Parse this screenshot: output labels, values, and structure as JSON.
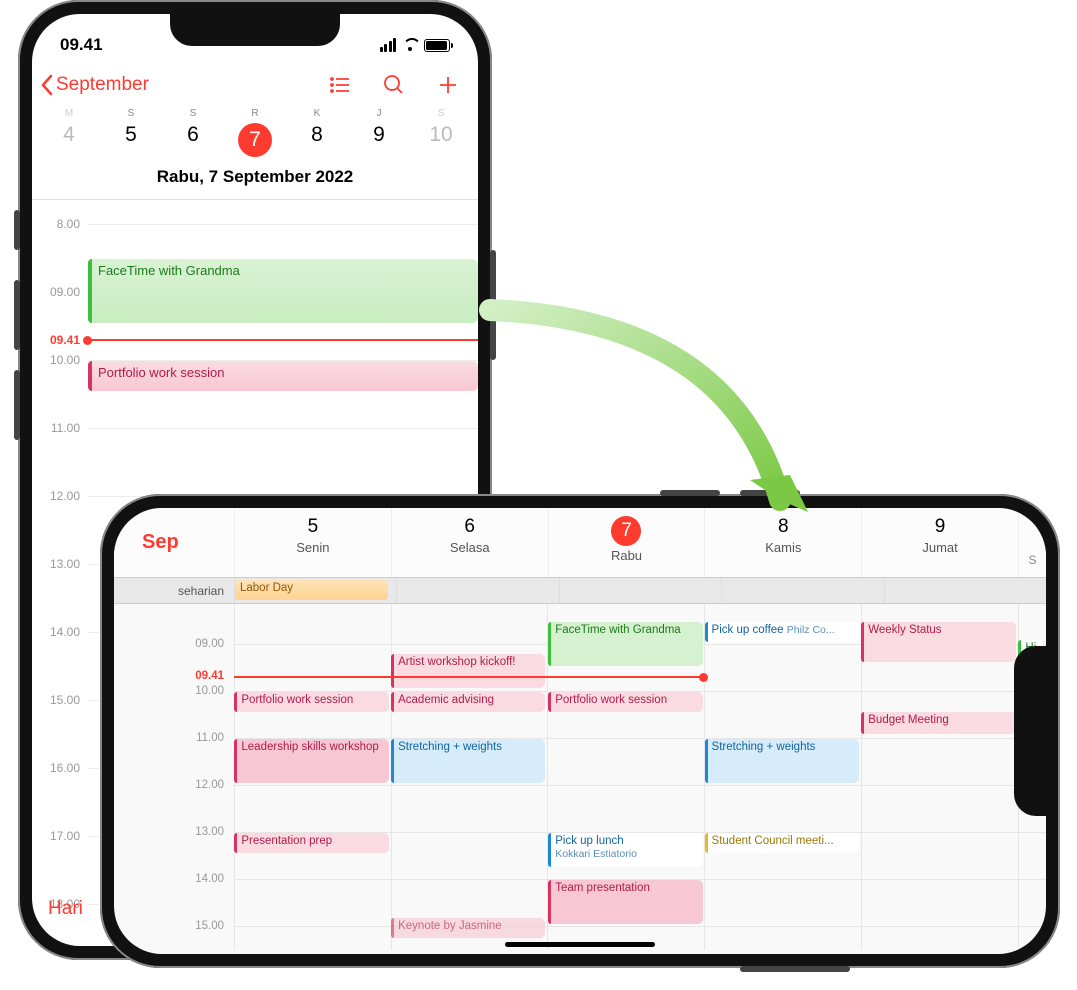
{
  "status": {
    "time": "09.41"
  },
  "nav": {
    "back": "September"
  },
  "portrait": {
    "dows": [
      "M",
      "S",
      "S",
      "R",
      "K",
      "J",
      "S"
    ],
    "dates": [
      "4",
      "5",
      "6",
      "7",
      "8",
      "9",
      "10"
    ],
    "selected_index": 3,
    "full_date": "Rabu, 7 September 2022",
    "hours": [
      "8.00",
      "09.00",
      "10.00",
      "11.00",
      "12.00",
      "13.00",
      "14.00",
      "15.00",
      "16.00",
      "17.00",
      "18.00"
    ],
    "now": "09.41",
    "ev1": "FaceTime with Grandma",
    "ev2": "Portfolio work session",
    "hari": "Hari"
  },
  "land": {
    "month": "Sep",
    "days": [
      {
        "num": "5",
        "name": "Senin"
      },
      {
        "num": "6",
        "name": "Selasa"
      },
      {
        "num": "7",
        "name": "Rabu"
      },
      {
        "num": "8",
        "name": "Kamis"
      },
      {
        "num": "9",
        "name": "Jumat"
      }
    ],
    "sel": 2,
    "last": "S",
    "allday_label": "seharian",
    "allday_ev": "Labor Day",
    "hours": [
      "09.00",
      "10.00",
      "11.00",
      "12.00",
      "13.00",
      "14.00",
      "15.00"
    ],
    "now": "09.41",
    "events": {
      "e1": "Artist workshop kickoff!",
      "e2": "FaceTime with Grandma",
      "e3": "Pick up coffee",
      "e3b": "Philz Co...",
      "e4": "Weekly Status",
      "e5": "Hi",
      "e6": "Portfolio work session",
      "e7": "Academic advising",
      "e8": "Portfolio work session",
      "e9": "Budget Meeting",
      "e10": "Leadership skills workshop",
      "e11": "Stretching + weights",
      "e12": "Stretching + weights",
      "e13": "Presentation prep",
      "e14": "Pick up lunch",
      "e14b": "Kokkari Estiatorio",
      "e15": "Student Council meeti...",
      "e16": "Team presentation",
      "e17": "Keynote by Jasmine"
    }
  }
}
